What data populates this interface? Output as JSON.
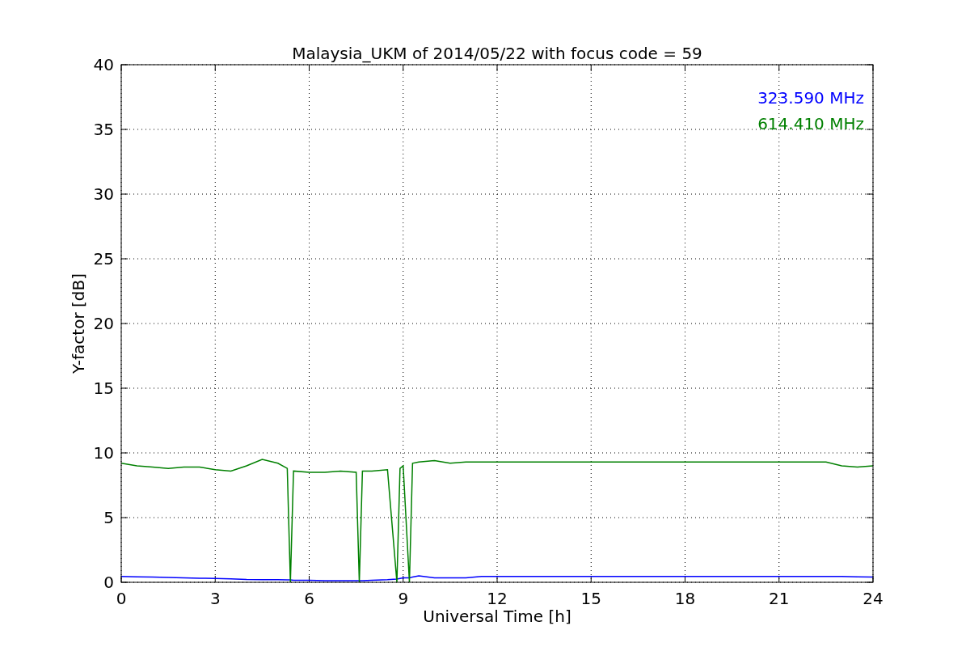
{
  "figure": {
    "chart_data": {
      "type": "line",
      "title": "Malaysia_UKM of 2014/05/22 with focus code = 59",
      "xlabel": "Universal Time [h]",
      "ylabel": "Y-factor [dB]",
      "x": [
        0,
        0.5,
        1,
        1.5,
        2,
        2.5,
        3,
        3.5,
        4,
        4.5,
        5,
        5.3,
        5.4,
        5.5,
        6,
        6.5,
        7,
        7.5,
        7.6,
        7.7,
        8,
        8.5,
        8.8,
        8.9,
        9,
        9.2,
        9.3,
        9.5,
        10,
        10.5,
        11,
        11.5,
        22.5,
        23,
        23.5,
        24
      ],
      "series": [
        {
          "name": "323.590 MHz",
          "color": "#0000ff",
          "values": [
            0.45,
            0.42,
            0.4,
            0.38,
            0.35,
            0.32,
            0.3,
            0.27,
            0.22,
            0.2,
            0.2,
            0.18,
            0.18,
            0.15,
            0.15,
            0.13,
            0.12,
            0.12,
            0.12,
            0.12,
            0.15,
            0.2,
            0.25,
            0.3,
            0.35,
            0.35,
            0.4,
            0.5,
            0.35,
            0.35,
            0.35,
            0.45,
            0.45,
            0.45,
            0.42,
            0.4
          ]
        },
        {
          "name": "614.410 MHz",
          "color": "#008000",
          "values": [
            9.2,
            9.0,
            8.9,
            8.8,
            8.9,
            8.9,
            8.7,
            8.6,
            9.0,
            9.5,
            9.2,
            8.8,
            0,
            8.6,
            8.5,
            8.5,
            8.6,
            8.5,
            0,
            8.6,
            8.6,
            8.7,
            0,
            8.8,
            9.0,
            0,
            9.2,
            9.3,
            9.4,
            9.2,
            9.3,
            9.3,
            9.3,
            9.0,
            8.9,
            9.0
          ]
        }
      ],
      "grid": true,
      "xlim": [
        0,
        24
      ],
      "ylim": [
        0,
        40
      ],
      "xticks": [
        0,
        3,
        6,
        9,
        12,
        15,
        18,
        21,
        24
      ],
      "yticks": [
        0,
        5,
        10,
        15,
        20,
        25,
        30,
        35,
        40
      ]
    }
  }
}
